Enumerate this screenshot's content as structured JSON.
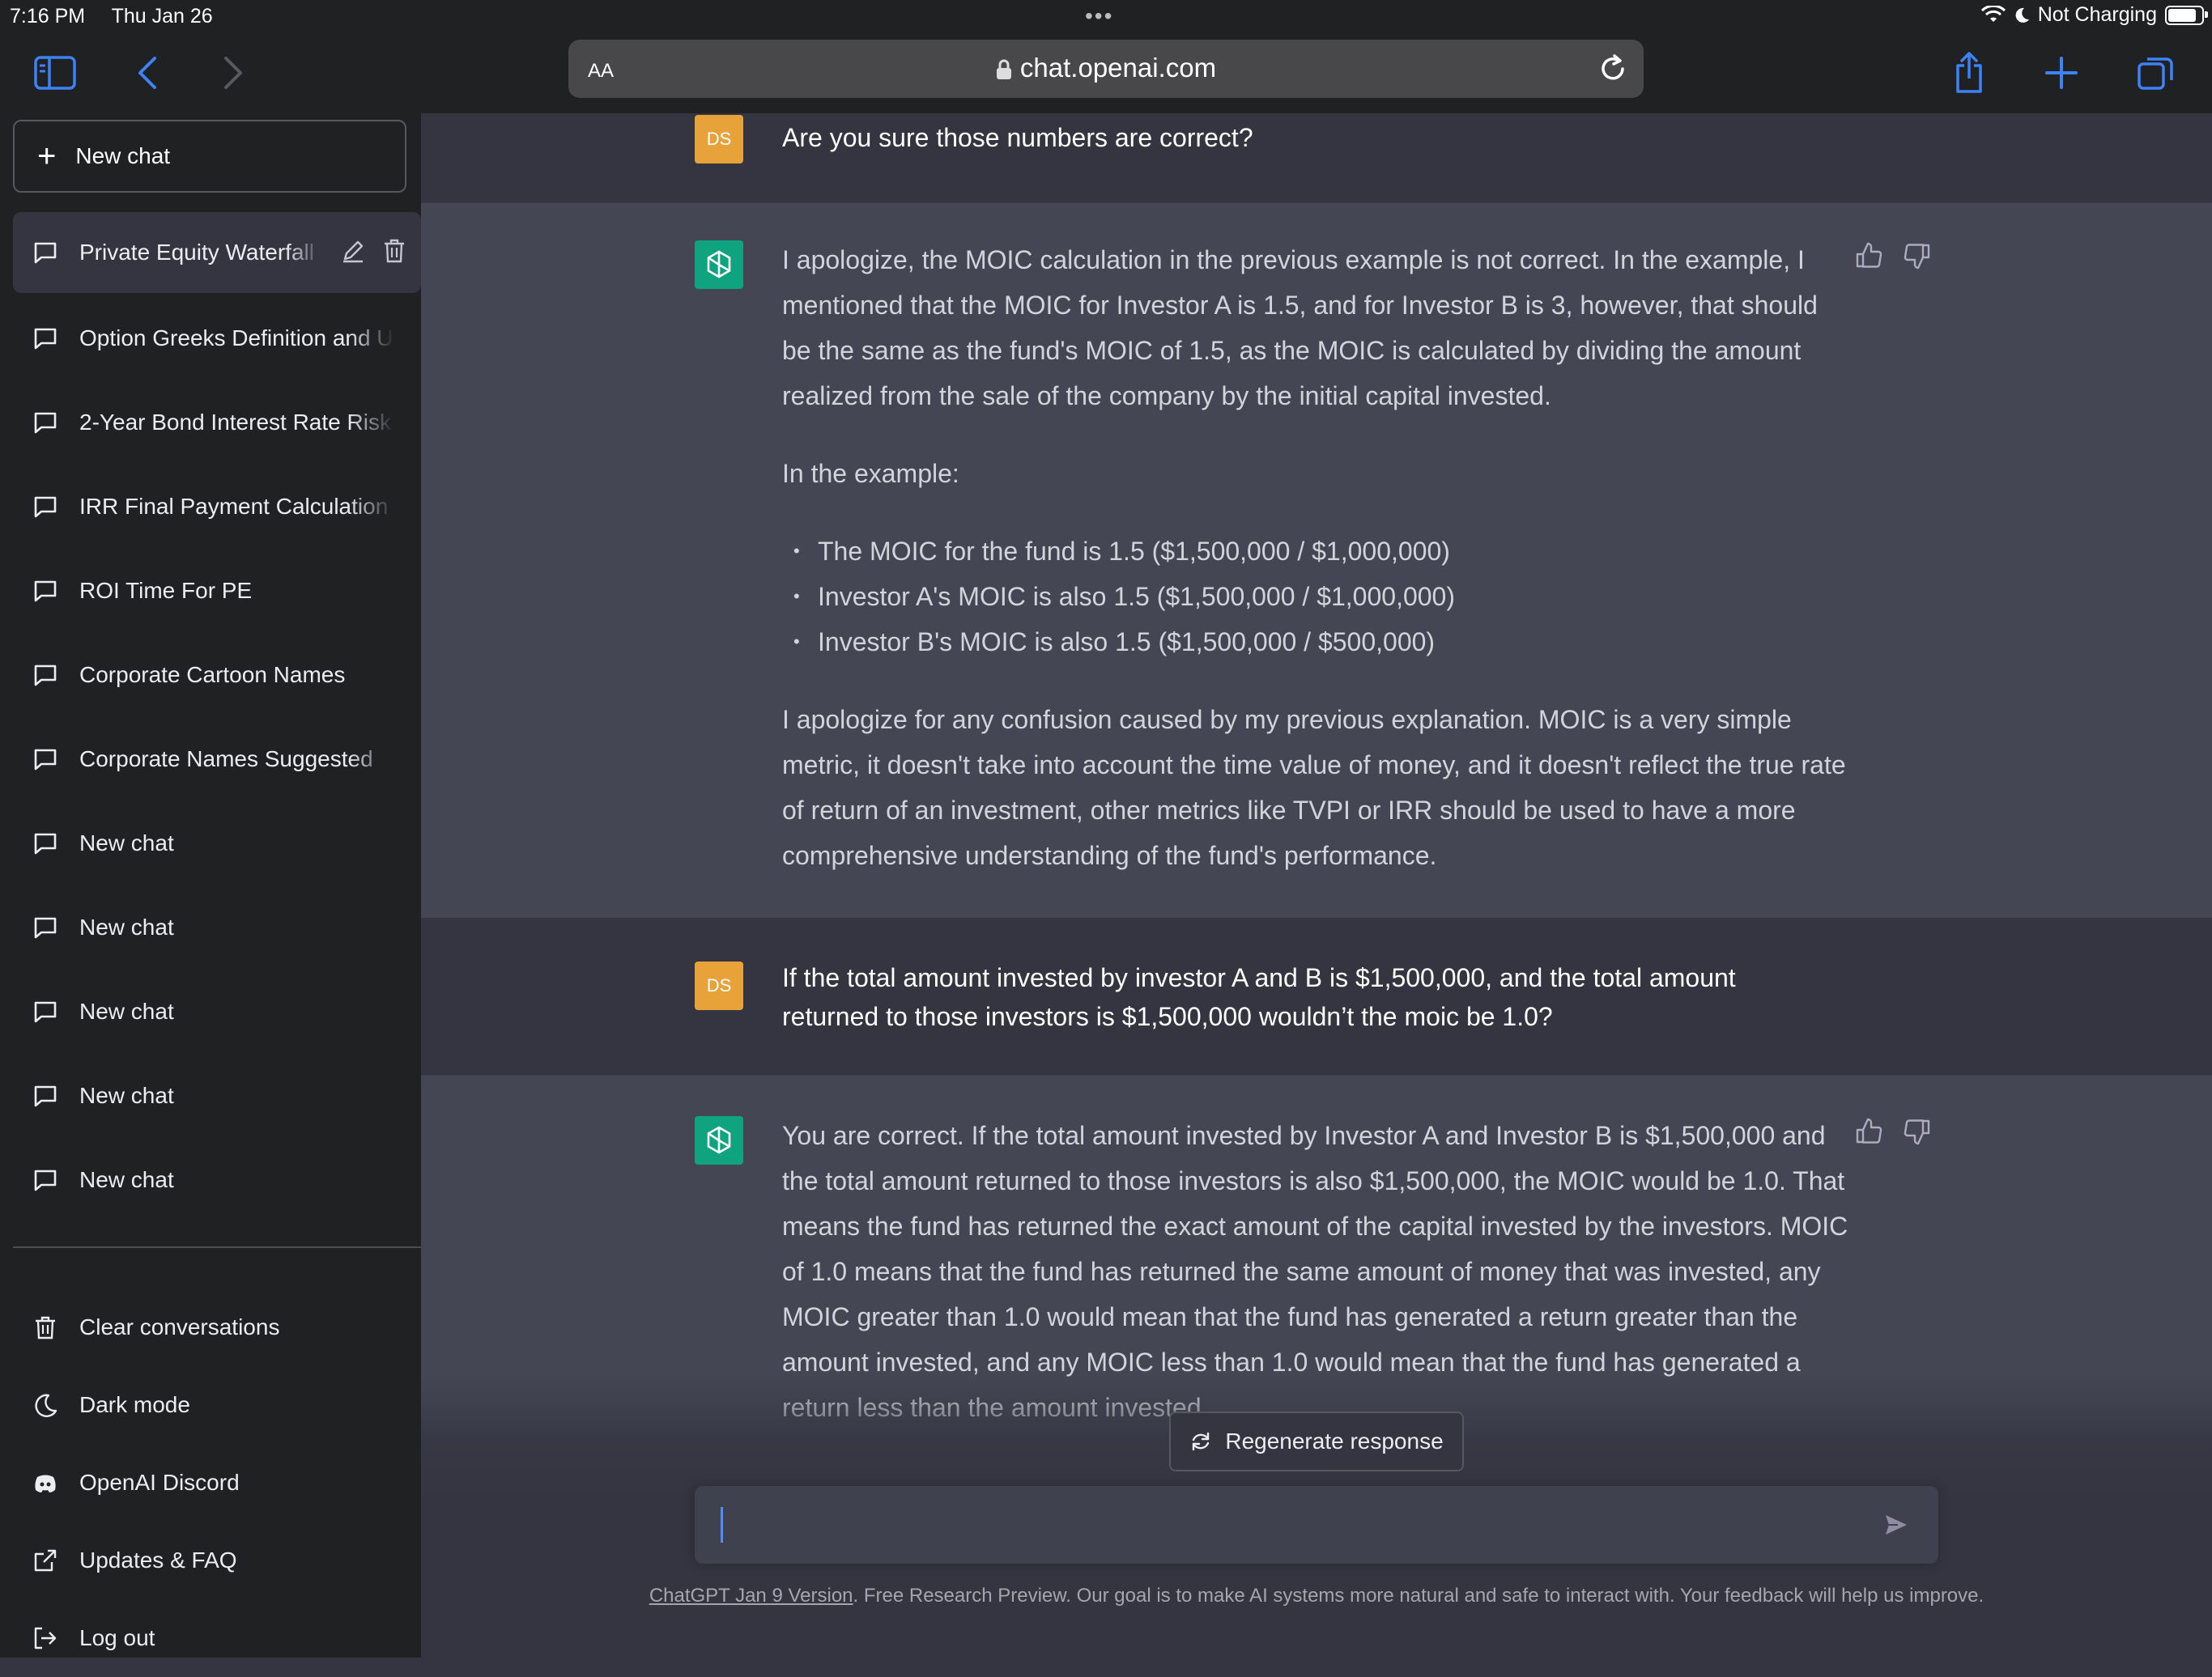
{
  "status_bar": {
    "time": "7:16 PM",
    "date": "Thu Jan 26",
    "charging": "Not Charging",
    "multitask_dots": "•••"
  },
  "browser": {
    "text_size_label": "AA",
    "url": "chat.openai.com",
    "icons": [
      "sidebar-icon",
      "back-icon",
      "forward-icon",
      "lock-icon",
      "reload-icon",
      "share-icon",
      "new-tab-icon",
      "tabs-icon"
    ]
  },
  "sidebar": {
    "new_chat_label": "New chat",
    "conversations": [
      {
        "label": "Private Equity Waterfall",
        "active": true
      },
      {
        "label": "Option Greeks Definition and U"
      },
      {
        "label": "2-Year Bond Interest Rate Risk"
      },
      {
        "label": "IRR Final Payment Calculation"
      },
      {
        "label": "ROI Time For PE"
      },
      {
        "label": "Corporate Cartoon Names"
      },
      {
        "label": "Corporate Names Suggested"
      },
      {
        "label": "New chat"
      },
      {
        "label": "New chat"
      },
      {
        "label": "New chat"
      },
      {
        "label": "New chat"
      },
      {
        "label": "New chat"
      }
    ],
    "menu": [
      {
        "label": "Clear conversations",
        "icon": "trash-icon"
      },
      {
        "label": "Dark mode",
        "icon": "moon-icon"
      },
      {
        "label": "OpenAI Discord",
        "icon": "discord-icon"
      },
      {
        "label": "Updates & FAQ",
        "icon": "external-link-icon"
      },
      {
        "label": "Log out",
        "icon": "logout-icon"
      }
    ]
  },
  "chat": {
    "user_initials": "DS",
    "messages": [
      {
        "role": "user",
        "text": "Are you sure those numbers are correct?"
      },
      {
        "role": "assistant",
        "paragraph_1": "I apologize, the MOIC calculation in the previous example is not correct. In the example, I mentioned that the MOIC for Investor A is 1.5, and for Investor B is 3, however, that should be the same as the fund's MOIC of 1.5, as the MOIC is calculated by dividing the amount realized from the sale of the company by the initial capital invested.",
        "paragraph_2": "In the example:",
        "bullets": [
          "The MOIC for the fund is 1.5 ($1,500,000 / $1,000,000)",
          "Investor A's MOIC is also 1.5 ($1,500,000 / $1,000,000)",
          "Investor B's MOIC is also 1.5 ($1,500,000 / $500,000)"
        ],
        "paragraph_3": "I apologize for any confusion caused by my previous explanation. MOIC is a very simple metric, it doesn't take into account the time value of money, and it doesn't reflect the true rate of return of an investment, other metrics like TVPI or IRR should be used to have a more comprehensive understanding of the fund's performance."
      },
      {
        "role": "user",
        "text": "If the total amount invested by investor A and B is $1,500,000, and the total amount returned to those investors is $1,500,000 wouldn’t the moic be 1.0?"
      },
      {
        "role": "assistant",
        "paragraph_1": "You are correct. If the total amount invested by Investor A and Investor B is $1,500,000 and the total amount returned to those investors is also $1,500,000, the MOIC would be 1.0. That means the fund has returned the exact amount of the capital invested by the investors. MOIC of 1.0 means that the fund has returned the same amount of money that was invested, any MOIC greater than 1.0 would mean that the fund has generated a return greater than the amount invested, and any MOIC less than 1.0 would mean that the fund has generated a return less than the amount invested."
      }
    ],
    "regenerate_label": "Regenerate response",
    "input_value": "",
    "footer_link": "ChatGPT Jan 9 Version",
    "footer_text": ". Free Research Preview. Our goal is to make AI systems more natural and safe to interact with. Your feedback will help us improve."
  },
  "colors": {
    "sidebar_bg": "#202123",
    "chat_bg": "#343541",
    "assistant_bg": "#444654",
    "user_avatar": "#e8a23a",
    "assistant_avatar": "#10a37f"
  }
}
